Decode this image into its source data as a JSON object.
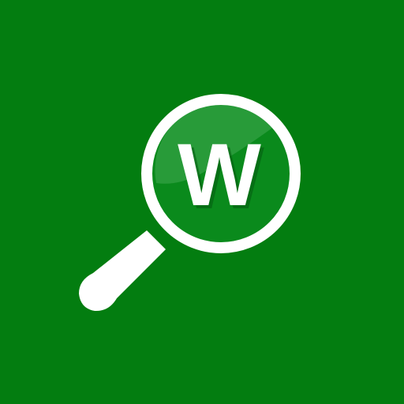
{
  "app_icon": {
    "letter": "W",
    "icon_name": "magnifying-glass-icon",
    "colors": {
      "background": "#037D10",
      "lens": "#0A8A1C",
      "lens_highlight": "#2E9E3E",
      "ring": "#FFFFFF",
      "handle": "#FFFFFF",
      "letter_fill": "#FFFFFF",
      "letter_shadow": "#055E11"
    }
  }
}
